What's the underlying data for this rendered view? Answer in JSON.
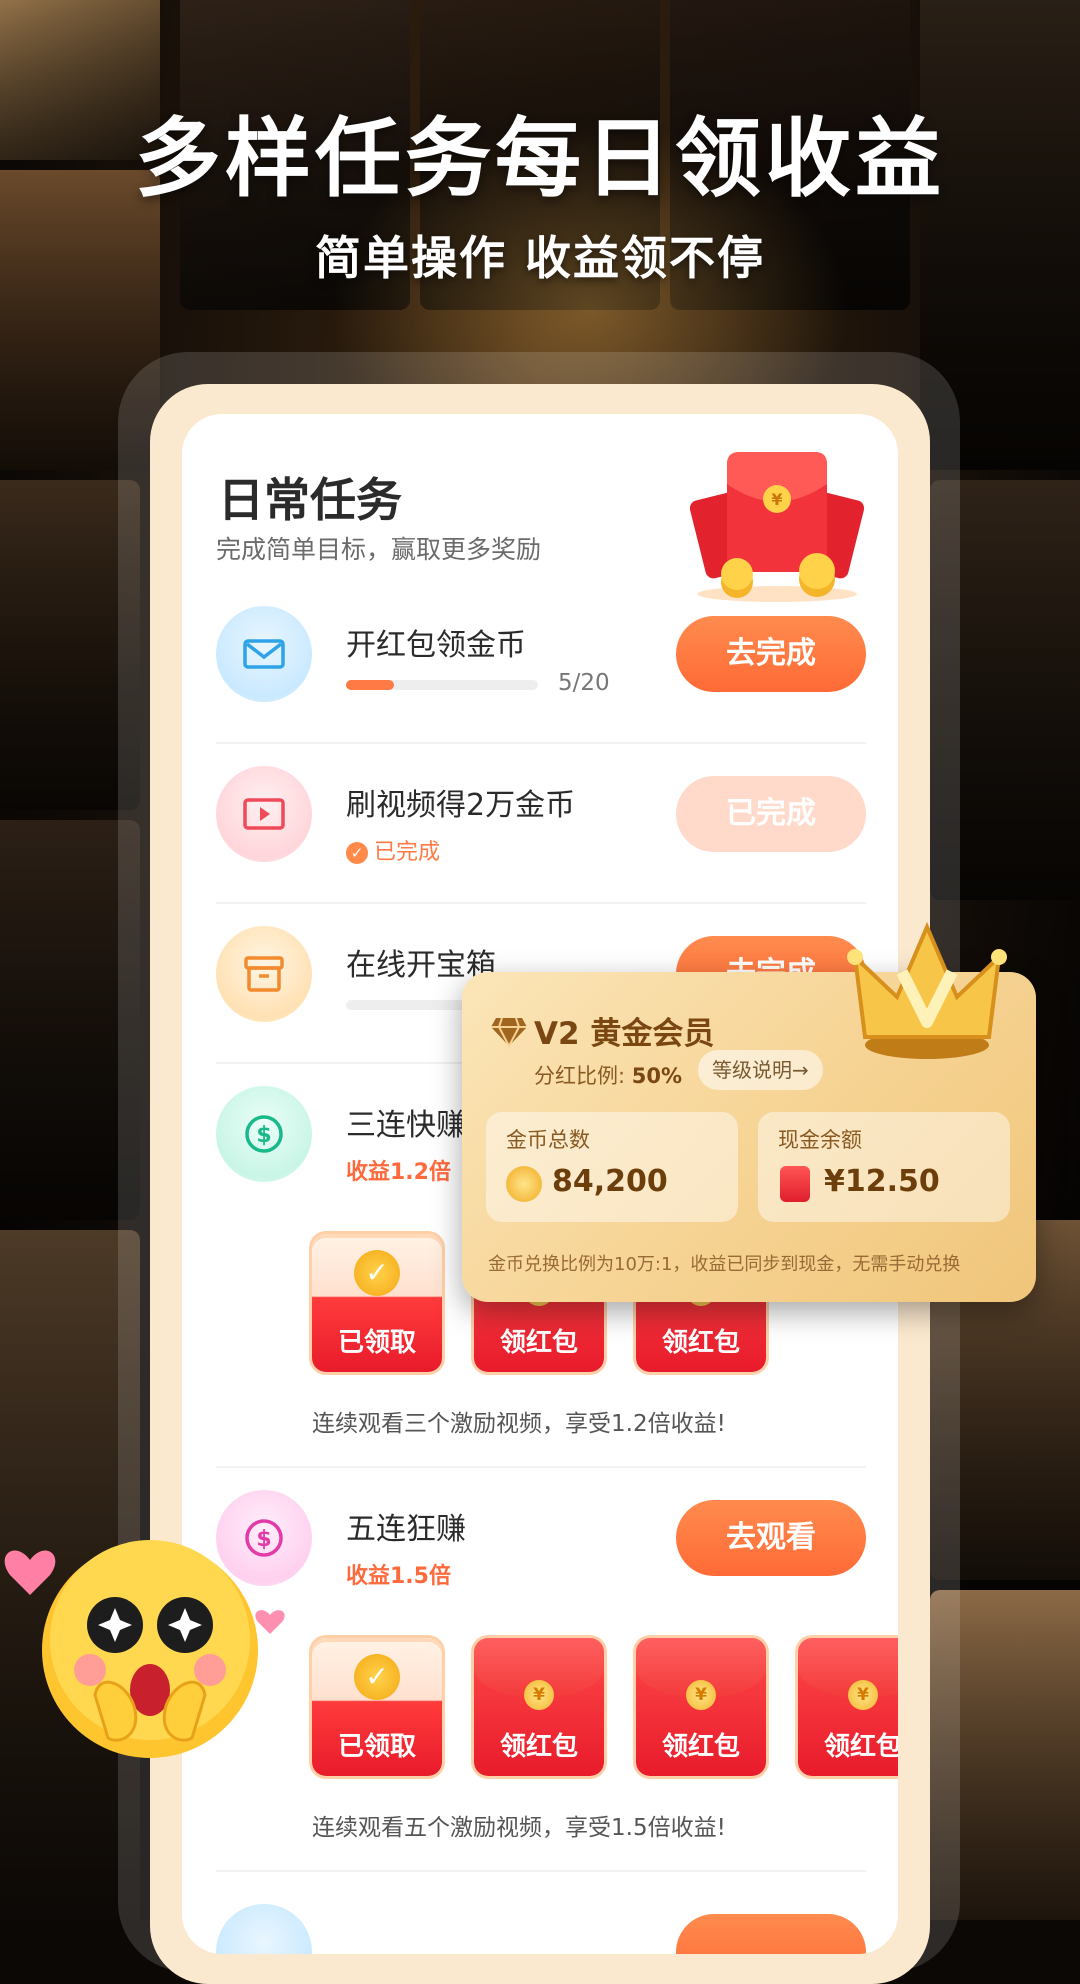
{
  "headline": {
    "title": "多样任务每日领收益",
    "subtitle": "简单操作 收益领不停"
  },
  "daily": {
    "title": "日常任务",
    "subtitle": "完成简单目标，赢取更多奖励"
  },
  "tasks": [
    {
      "name": "开红包领金币",
      "progress_text": "5/20",
      "progress_fraction": 0.25,
      "button": "去完成",
      "icon": "mail-icon"
    },
    {
      "name": "刷视频得2万金币",
      "status": "已完成",
      "button": "已完成",
      "icon": "video-icon"
    },
    {
      "name": "在线开宝箱",
      "button": "去完成",
      "icon": "box-icon"
    },
    {
      "name": "三连快赚",
      "bonus": "收益1.2倍",
      "icon": "dollar-icon",
      "packets": [
        "已领取",
        "领红包",
        "领红包"
      ],
      "desc": "连续观看三个激励视频，享受1.2倍收益!"
    },
    {
      "name": "五连狂赚",
      "bonus": "收益1.5倍",
      "button": "去观看",
      "icon": "dollar-icon",
      "packets": [
        "已领取",
        "领红包",
        "领红包",
        "领红包"
      ],
      "desc": "连续观看五个激励视频，享受1.5倍收益!"
    }
  ],
  "vip": {
    "title": "V2 黄金会员",
    "ratio_label": "分红比例:",
    "ratio_value": "50%",
    "link": "等级说明→",
    "coins_label": "金币总数",
    "coins_value": "84,200",
    "cash_label": "现金余额",
    "cash_value": "¥12.50",
    "note": "金币兑换比例为10万:1，收益已同步到现金，无需手动兑换"
  },
  "colors": {
    "accent": "#ff6a36",
    "gold": "#f6d393",
    "bonus": "#ff6a3d"
  }
}
